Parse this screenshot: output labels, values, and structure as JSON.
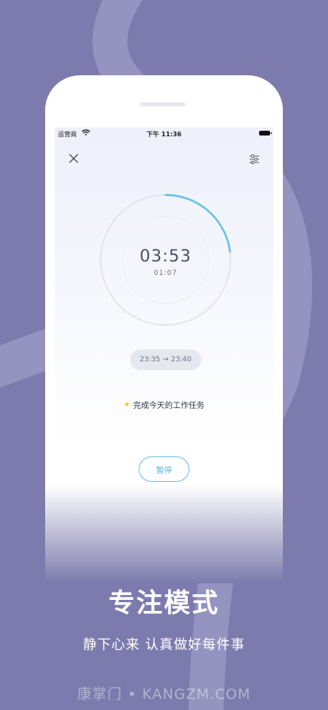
{
  "colors": {
    "background": "#7d7aad",
    "accent": "#52b0de",
    "progress_arc": "#60c2e6",
    "star": "#f3c42a"
  },
  "status_bar": {
    "carrier": "运营商",
    "time": "下午 11:36"
  },
  "toolbar": {
    "close_icon": "close-icon",
    "settings_icon": "sliders-icon"
  },
  "timer": {
    "remaining": "03:53",
    "elapsed": "01:07",
    "progress": 0.23
  },
  "session": {
    "start": "23:35",
    "end": "23:40",
    "arrow": "→"
  },
  "task": {
    "star": "★",
    "title": "完成今天的工作任务"
  },
  "pause_label": "暂停",
  "promo": {
    "headline": "专注模式",
    "subline": "静下心来 认真做好每件事"
  },
  "watermark": "康掌门 • KANGZM.COM"
}
